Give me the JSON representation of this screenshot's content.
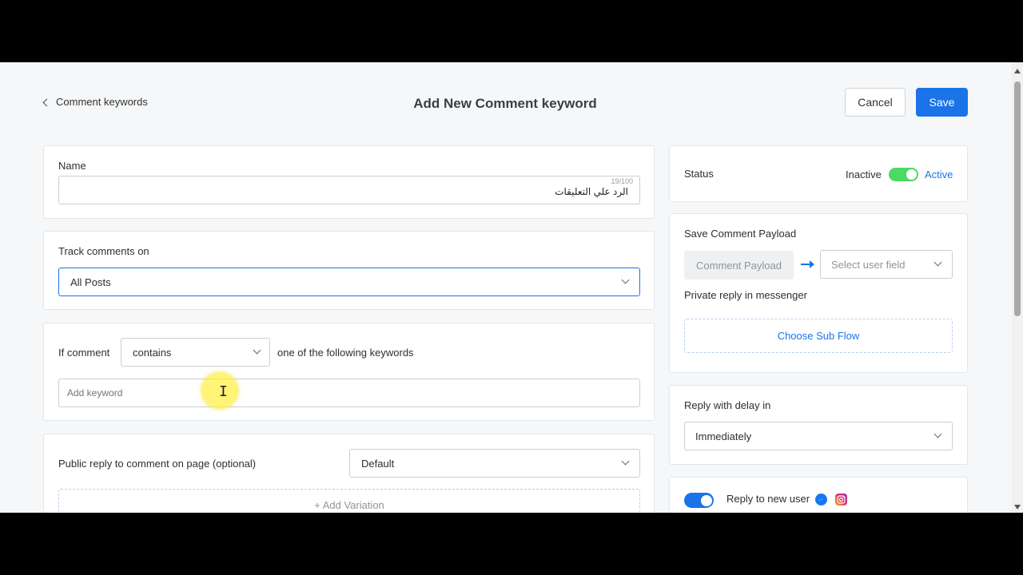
{
  "header": {
    "back_label": "Comment keywords",
    "title": "Add New Comment keyword",
    "cancel_label": "Cancel",
    "save_label": "Save"
  },
  "name_card": {
    "label": "Name",
    "value": "الرد علي التعليقات",
    "counter": "19/100"
  },
  "track_card": {
    "label": "Track comments on",
    "selected": "All Posts"
  },
  "keyword_card": {
    "prefix": "If comment",
    "condition": "contains",
    "suffix": "one of the following keywords",
    "placeholder": "Add keyword"
  },
  "public_reply_card": {
    "label": "Public reply to comment on page (optional)",
    "selected": "Default",
    "add_variation": "+ Add Variation"
  },
  "status_card": {
    "label": "Status",
    "inactive": "Inactive",
    "active": "Active",
    "enabled": true
  },
  "payload_card": {
    "label": "Save Comment Payload",
    "payload_button": "Comment Payload",
    "user_field_placeholder": "Select user field",
    "private_reply_label": "Private reply in messenger",
    "choose_subflow": "Choose Sub Flow"
  },
  "delay_card": {
    "label": "Reply with delay in",
    "selected": "Immediately"
  },
  "new_user_card": {
    "label": "Reply to new user",
    "enabled": true
  },
  "colors": {
    "accent": "#1a73e8",
    "toggle_green": "#4cd964",
    "messenger": "#1877f2",
    "instagram": "#e1306c"
  }
}
